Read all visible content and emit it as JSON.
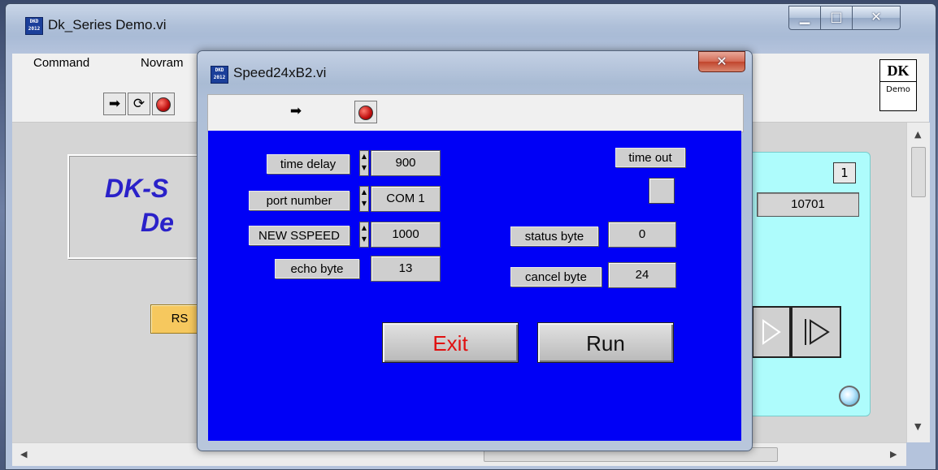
{
  "main_window": {
    "title": "Dk_Series Demo.vi",
    "icon_text": [
      "DKD",
      "2012"
    ],
    "menu": [
      "Command",
      "Novram"
    ],
    "logo": {
      "big": "DK",
      "small": "Demo"
    },
    "banner": {
      "line1": "DK-S",
      "line2": "De"
    },
    "rs_button_label": "RS",
    "cyan_panel": {
      "index": "1",
      "value": "10701"
    }
  },
  "dialog": {
    "title": "Speed24xB2.vi",
    "icon_text": [
      "DKD",
      "2012"
    ],
    "fields": {
      "time_delay": {
        "label": "time delay",
        "value": "900"
      },
      "port_number": {
        "label": "port number",
        "value": "COM 1"
      },
      "new_speed": {
        "label": "NEW SSPEED",
        "value": "1000"
      },
      "echo_byte": {
        "label": "echo  byte",
        "value": "13"
      },
      "time_out": {
        "label": "time out"
      },
      "status_byte": {
        "label": "status byte",
        "value": "0"
      },
      "cancel_byte": {
        "label": "cancel byte",
        "value": "24"
      }
    },
    "buttons": {
      "exit": "Exit",
      "run": "Run"
    },
    "colors": {
      "body": "#0000f6",
      "exit_text": "#e01010"
    }
  }
}
